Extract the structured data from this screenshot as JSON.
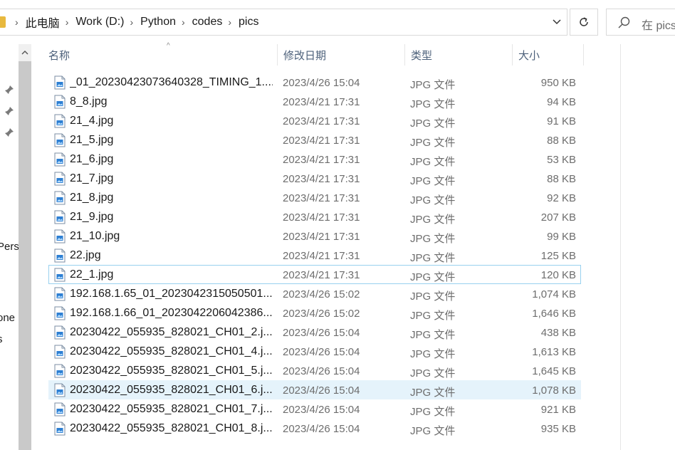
{
  "breadcrumb": {
    "items": [
      "此电脑",
      "Work (D:)",
      "Python",
      "codes",
      "pics"
    ]
  },
  "search": {
    "placeholder": "在 pics"
  },
  "nav": {
    "labels": [
      "Pers",
      "one",
      "s"
    ]
  },
  "columns": {
    "name": "名称",
    "modified": "修改日期",
    "type": "类型",
    "size": "大小"
  },
  "files": [
    {
      "name": "_01_20230423073640328_TIMING_1....",
      "modified": "2023/4/26 15:04",
      "type": "JPG 文件",
      "size": "950 KB"
    },
    {
      "name": "8_8.jpg",
      "modified": "2023/4/21 17:31",
      "type": "JPG 文件",
      "size": "94 KB"
    },
    {
      "name": "21_4.jpg",
      "modified": "2023/4/21 17:31",
      "type": "JPG 文件",
      "size": "91 KB"
    },
    {
      "name": "21_5.jpg",
      "modified": "2023/4/21 17:31",
      "type": "JPG 文件",
      "size": "88 KB"
    },
    {
      "name": "21_6.jpg",
      "modified": "2023/4/21 17:31",
      "type": "JPG 文件",
      "size": "53 KB"
    },
    {
      "name": "21_7.jpg",
      "modified": "2023/4/21 17:31",
      "type": "JPG 文件",
      "size": "88 KB"
    },
    {
      "name": "21_8.jpg",
      "modified": "2023/4/21 17:31",
      "type": "JPG 文件",
      "size": "92 KB"
    },
    {
      "name": "21_9.jpg",
      "modified": "2023/4/21 17:31",
      "type": "JPG 文件",
      "size": "207 KB"
    },
    {
      "name": "21_10.jpg",
      "modified": "2023/4/21 17:31",
      "type": "JPG 文件",
      "size": "99 KB"
    },
    {
      "name": "22.jpg",
      "modified": "2023/4/21 17:31",
      "type": "JPG 文件",
      "size": "125 KB"
    },
    {
      "name": "22_1.jpg",
      "modified": "2023/4/21 17:31",
      "type": "JPG 文件",
      "size": "120 KB"
    },
    {
      "name": "192.168.1.65_01_2023042315050501...",
      "modified": "2023/4/26 15:02",
      "type": "JPG 文件",
      "size": "1,074 KB"
    },
    {
      "name": "192.168.1.66_01_2023042206042386...",
      "modified": "2023/4/26 15:02",
      "type": "JPG 文件",
      "size": "1,646 KB"
    },
    {
      "name": "20230422_055935_828021_CH01_2.j...",
      "modified": "2023/4/26 15:04",
      "type": "JPG 文件",
      "size": "438 KB"
    },
    {
      "name": "20230422_055935_828021_CH01_4.j...",
      "modified": "2023/4/26 15:04",
      "type": "JPG 文件",
      "size": "1,613 KB"
    },
    {
      "name": "20230422_055935_828021_CH01_5.j...",
      "modified": "2023/4/26 15:04",
      "type": "JPG 文件",
      "size": "1,645 KB"
    },
    {
      "name": "20230422_055935_828021_CH01_6.j...",
      "modified": "2023/4/26 15:04",
      "type": "JPG 文件",
      "size": "1,078 KB"
    },
    {
      "name": "20230422_055935_828021_CH01_7.j...",
      "modified": "2023/4/26 15:04",
      "type": "JPG 文件",
      "size": "921 KB"
    },
    {
      "name": "20230422_055935_828021_CH01_8.j...",
      "modified": "2023/4/26 15:04",
      "type": "JPG 文件",
      "size": "935 KB"
    }
  ],
  "colors": {
    "accent_hover": "#e5f3fb",
    "focus_border": "#99d1ef",
    "header_text": "#4c607a"
  }
}
